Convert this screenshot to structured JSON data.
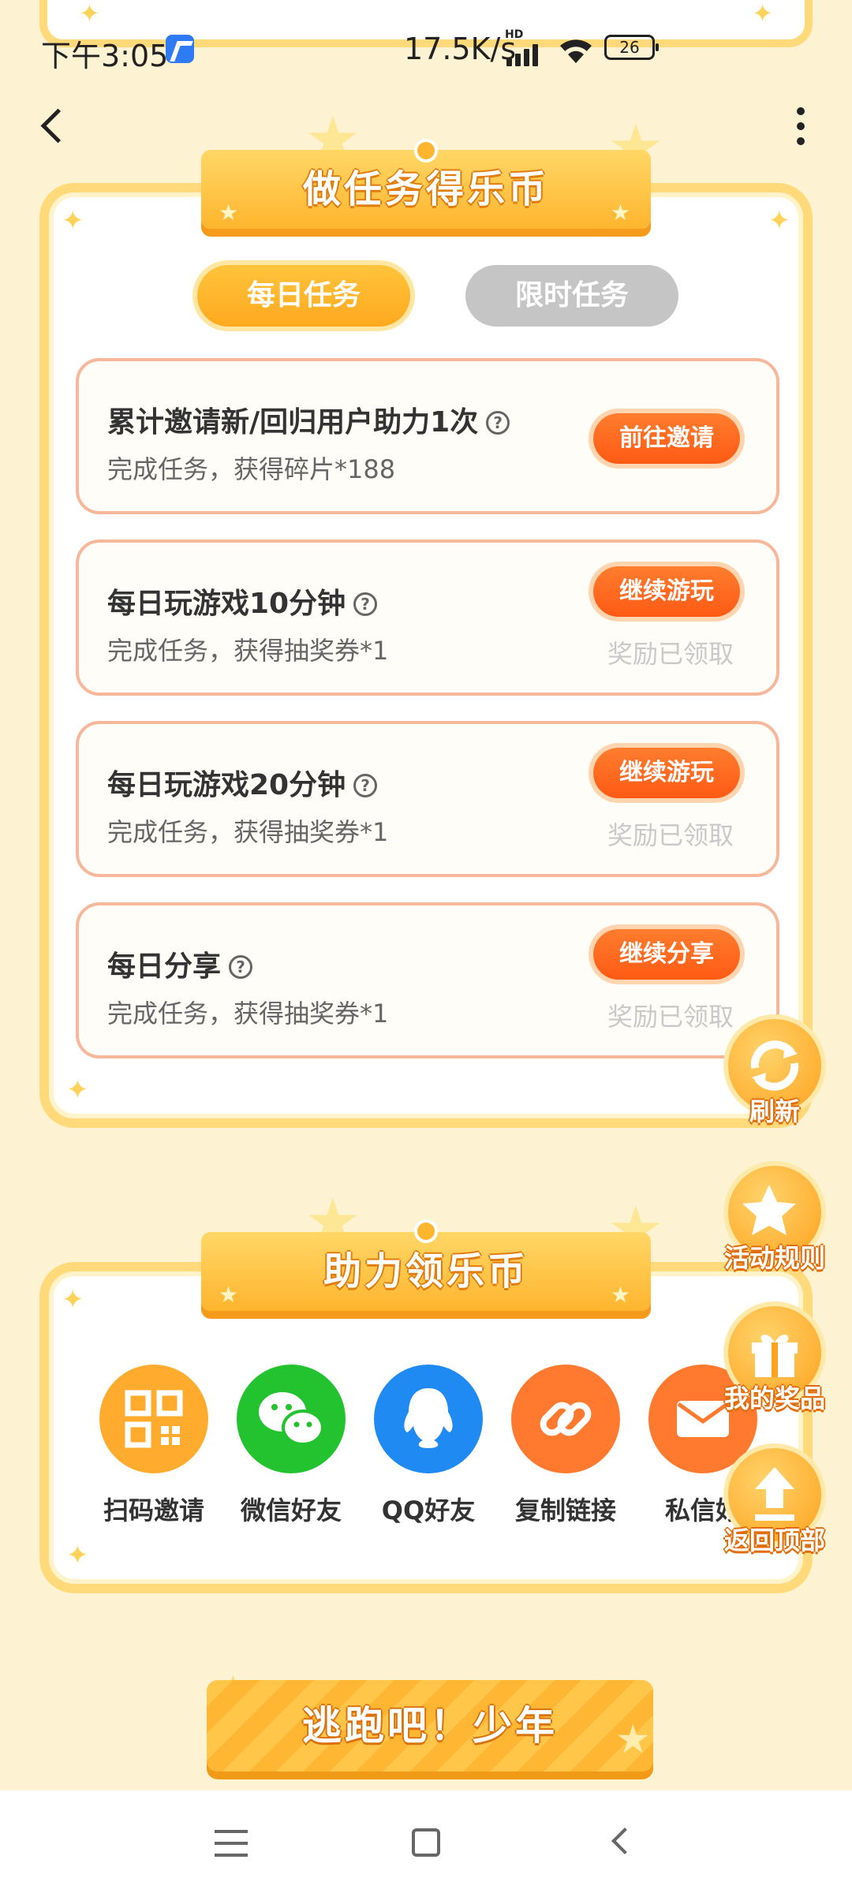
{
  "status_bar": {
    "time": "下午3:05",
    "network_speed": "17.5K/s",
    "hd": "HD",
    "battery": "26"
  },
  "tasks_section": {
    "title": "做任务得乐币",
    "tabs": [
      {
        "label": "每日任务",
        "active": true
      },
      {
        "label": "限时任务",
        "active": false
      }
    ],
    "items": [
      {
        "title": "累计邀请新/回归用户助力1次",
        "desc": "完成任务，获得碎片*188",
        "button": "前往邀请",
        "claimed": ""
      },
      {
        "title": "每日玩游戏10分钟",
        "desc": "完成任务，获得抽奖券*1",
        "button": "继续游玩",
        "claimed": "奖励已领取"
      },
      {
        "title": "每日玩游戏20分钟",
        "desc": "完成任务，获得抽奖券*1",
        "button": "继续游玩",
        "claimed": "奖励已领取"
      },
      {
        "title": "每日分享",
        "desc": "完成任务，获得抽奖券*1",
        "button": "继续分享",
        "claimed": "奖励已领取"
      }
    ]
  },
  "help_section": {
    "title": "助力领乐币",
    "share": [
      {
        "label": "扫码邀请",
        "icon": "qr-code-icon",
        "color": "#ffac2e"
      },
      {
        "label": "微信好友",
        "icon": "wechat-icon",
        "color": "#22c32e"
      },
      {
        "label": "QQ好友",
        "icon": "qq-icon",
        "color": "#1f8bf2"
      },
      {
        "label": "复制链接",
        "icon": "link-icon",
        "color": "#ff7a2e"
      },
      {
        "label": "私信好",
        "icon": "mail-icon",
        "color": "#ff7a2e"
      }
    ]
  },
  "floating": {
    "refresh": "刷新",
    "rules": "活动规则",
    "prizes": "我的奖品",
    "top": "返回顶部"
  },
  "game_banner": "逃跑吧！少年",
  "colors": {
    "background": "#fdf3d3",
    "accent_orange": "#ff5a14",
    "banner_yellow": "#ffb52e"
  }
}
